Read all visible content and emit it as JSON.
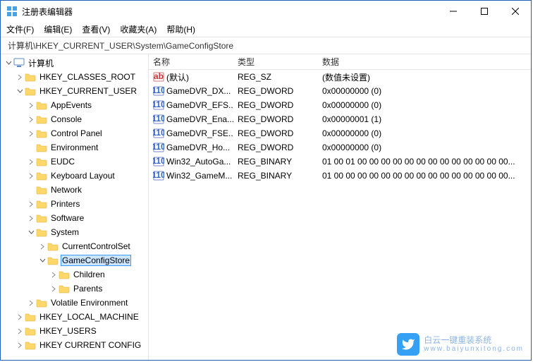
{
  "window": {
    "title": "注册表编辑器"
  },
  "menu": {
    "file": "文件(F)",
    "edit": "编辑(E)",
    "view": "查看(V)",
    "favorites": "收藏夹(A)",
    "help": "帮助(H)"
  },
  "address": "计算机\\HKEY_CURRENT_USER\\System\\GameConfigStore",
  "tree": {
    "root": "计算机",
    "hkcr": "HKEY_CLASSES_ROOT",
    "hkcu": "HKEY_CURRENT_USER",
    "appevents": "AppEvents",
    "console": "Console",
    "controlpanel": "Control Panel",
    "environment": "Environment",
    "eudc": "EUDC",
    "keyboard": "Keyboard Layout",
    "network": "Network",
    "printers": "Printers",
    "software": "Software",
    "system": "System",
    "currentcontrolset": "CurrentControlSet",
    "gameconfigstore": "GameConfigStore",
    "children": "Children",
    "parents": "Parents",
    "volatile": "Volatile Environment",
    "hklm": "HKEY_LOCAL_MACHINE",
    "hku": "HKEY_USERS",
    "hkcc": "HKEY CURRENT CONFIG"
  },
  "columns": {
    "name": "名称",
    "type": "类型",
    "data": "数据"
  },
  "rows": [
    {
      "icon": "string",
      "name": "(默认)",
      "type": "REG_SZ",
      "data": "(数值未设置)"
    },
    {
      "icon": "binary",
      "name": "GameDVR_DX...",
      "type": "REG_DWORD",
      "data": "0x00000000 (0)"
    },
    {
      "icon": "binary",
      "name": "GameDVR_EFS...",
      "type": "REG_DWORD",
      "data": "0x00000000 (0)"
    },
    {
      "icon": "binary",
      "name": "GameDVR_Ena...",
      "type": "REG_DWORD",
      "data": "0x00000001 (1)"
    },
    {
      "icon": "binary",
      "name": "GameDVR_FSE...",
      "type": "REG_DWORD",
      "data": "0x00000000 (0)"
    },
    {
      "icon": "binary",
      "name": "GameDVR_Ho...",
      "type": "REG_DWORD",
      "data": "0x00000000 (0)"
    },
    {
      "icon": "binary",
      "name": "Win32_AutoGa...",
      "type": "REG_BINARY",
      "data": "01 00 01 00 00 00 00 00 00 00 00 00 00 00 00 00..."
    },
    {
      "icon": "binary",
      "name": "Win32_GameM...",
      "type": "REG_BINARY",
      "data": "01 00 00 00 00 00 00 00 00 00 00 00 00 00 00 00..."
    }
  ],
  "watermark": {
    "main": "白云一键重装系统",
    "sub": "www.baiyunxitong.com"
  }
}
